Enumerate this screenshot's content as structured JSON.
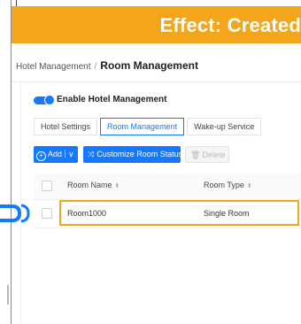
{
  "banner": {
    "title": "Effect: Created"
  },
  "breadcrumb": {
    "parent": "Hotel Management",
    "separator": "/",
    "current": "Room Management"
  },
  "toggle": {
    "label": "Enable Hotel Management",
    "state": "on"
  },
  "tabs": [
    {
      "label": "Hotel Settings",
      "active": false
    },
    {
      "label": "Room Management",
      "active": true
    },
    {
      "label": "Wake-up Service",
      "active": false
    }
  ],
  "toolbar": {
    "add_label": "Add",
    "customize_label": "Customize Room Status",
    "delete_label": "Delete"
  },
  "table": {
    "columns": [
      "Room Name",
      "Room Type"
    ],
    "rows": [
      {
        "room_name": "Room1000",
        "room_type": "Single Room"
      }
    ]
  },
  "colors": {
    "accent": "#1677ff",
    "highlight": "#f3a51b",
    "banner_text": "#ffffff"
  }
}
